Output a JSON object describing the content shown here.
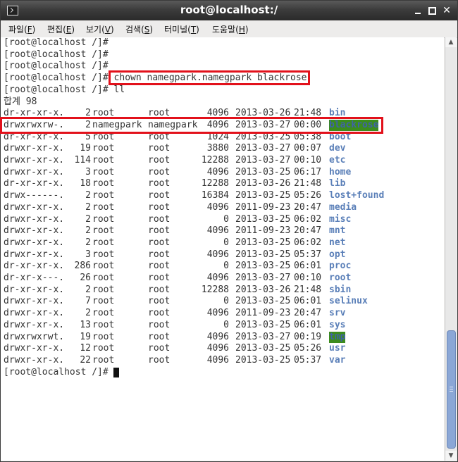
{
  "window": {
    "title": "root@localhost:/"
  },
  "menu": [
    {
      "label": "파일(",
      "key": "F",
      "end": ")"
    },
    {
      "label": "편집(",
      "key": "E",
      "end": ")"
    },
    {
      "label": "보기(",
      "key": "V",
      "end": ")"
    },
    {
      "label": "검색(",
      "key": "S",
      "end": ")"
    },
    {
      "label": "터미널(",
      "key": "T",
      "end": ")"
    },
    {
      "label": "도움말(",
      "key": "H",
      "end": ")"
    }
  ],
  "prompts": [
    "[root@localhost /]#",
    "[root@localhost /]#",
    "[root@localhost /]#"
  ],
  "command1": {
    "prompt": "[root@localhost /]#",
    "command": "chown namegpark.namegpark blackrose"
  },
  "command2": {
    "prompt": "[root@localhost /]#",
    "command": "ll"
  },
  "total": "합계 98",
  "listing": [
    {
      "perm": "dr-xr-xr-x.",
      "links": "2",
      "owner": "root",
      "group": "root",
      "size": "4096",
      "date": "2013-03-26",
      "time": "21:48",
      "name": "bin"
    },
    {
      "perm": "drwxrwxrw-.",
      "links": "2",
      "owner": "namegpark",
      "group": "namegpark",
      "size": "4096",
      "date": "2013-03-27",
      "time": "00:00",
      "name": "blackrose",
      "hl": true
    },
    {
      "perm": "dr-xr-xr-x.",
      "links": "5",
      "owner": "root",
      "group": "root",
      "size": "1024",
      "date": "2013-03-25",
      "time": "05:38",
      "name": "boot"
    },
    {
      "perm": "drwxr-xr-x.",
      "links": "19",
      "owner": "root",
      "group": "root",
      "size": "3880",
      "date": "2013-03-27",
      "time": "00:07",
      "name": "dev"
    },
    {
      "perm": "drwxr-xr-x.",
      "links": "114",
      "owner": "root",
      "group": "root",
      "size": "12288",
      "date": "2013-03-27",
      "time": "00:10",
      "name": "etc"
    },
    {
      "perm": "drwxr-xr-x.",
      "links": "3",
      "owner": "root",
      "group": "root",
      "size": "4096",
      "date": "2013-03-25",
      "time": "06:17",
      "name": "home"
    },
    {
      "perm": "dr-xr-xr-x.",
      "links": "18",
      "owner": "root",
      "group": "root",
      "size": "12288",
      "date": "2013-03-26",
      "time": "21:48",
      "name": "lib"
    },
    {
      "perm": "drwx------.",
      "links": "2",
      "owner": "root",
      "group": "root",
      "size": "16384",
      "date": "2013-03-25",
      "time": "05:26",
      "name": "lost+found"
    },
    {
      "perm": "drwxr-xr-x.",
      "links": "2",
      "owner": "root",
      "group": "root",
      "size": "4096",
      "date": "2011-09-23",
      "time": "20:47",
      "name": "media"
    },
    {
      "perm": "drwxr-xr-x.",
      "links": "2",
      "owner": "root",
      "group": "root",
      "size": "0",
      "date": "2013-03-25",
      "time": "06:02",
      "name": "misc"
    },
    {
      "perm": "drwxr-xr-x.",
      "links": "2",
      "owner": "root",
      "group": "root",
      "size": "4096",
      "date": "2011-09-23",
      "time": "20:47",
      "name": "mnt"
    },
    {
      "perm": "drwxr-xr-x.",
      "links": "2",
      "owner": "root",
      "group": "root",
      "size": "0",
      "date": "2013-03-25",
      "time": "06:02",
      "name": "net"
    },
    {
      "perm": "drwxr-xr-x.",
      "links": "3",
      "owner": "root",
      "group": "root",
      "size": "4096",
      "date": "2013-03-25",
      "time": "05:37",
      "name": "opt"
    },
    {
      "perm": "dr-xr-xr-x.",
      "links": "286",
      "owner": "root",
      "group": "root",
      "size": "0",
      "date": "2013-03-25",
      "time": "06:01",
      "name": "proc"
    },
    {
      "perm": "dr-xr-x---.",
      "links": "26",
      "owner": "root",
      "group": "root",
      "size": "4096",
      "date": "2013-03-27",
      "time": "00:10",
      "name": "root"
    },
    {
      "perm": "dr-xr-xr-x.",
      "links": "2",
      "owner": "root",
      "group": "root",
      "size": "12288",
      "date": "2013-03-26",
      "time": "21:48",
      "name": "sbin"
    },
    {
      "perm": "drwxr-xr-x.",
      "links": "7",
      "owner": "root",
      "group": "root",
      "size": "0",
      "date": "2013-03-25",
      "time": "06:01",
      "name": "selinux"
    },
    {
      "perm": "drwxr-xr-x.",
      "links": "2",
      "owner": "root",
      "group": "root",
      "size": "4096",
      "date": "2011-09-23",
      "time": "20:47",
      "name": "srv"
    },
    {
      "perm": "drwxr-xr-x.",
      "links": "13",
      "owner": "root",
      "group": "root",
      "size": "0",
      "date": "2013-03-25",
      "time": "06:01",
      "name": "sys"
    },
    {
      "perm": "drwxrwxrwt.",
      "links": "19",
      "owner": "root",
      "group": "root",
      "size": "4096",
      "date": "2013-03-27",
      "time": "00:19",
      "name": "tmp",
      "hl": true
    },
    {
      "perm": "drwxr-xr-x.",
      "links": "12",
      "owner": "root",
      "group": "root",
      "size": "4096",
      "date": "2013-03-25",
      "time": "05:26",
      "name": "usr"
    },
    {
      "perm": "drwxr-xr-x.",
      "links": "22",
      "owner": "root",
      "group": "root",
      "size": "4096",
      "date": "2013-03-25",
      "time": "05:37",
      "name": "var"
    }
  ],
  "final_prompt": "[root@localhost /]#",
  "colors": {
    "highlight_box": "#e2111b",
    "dir_name": "#5a7fb8",
    "dir_highlight_bg": "#3c8c1e"
  }
}
